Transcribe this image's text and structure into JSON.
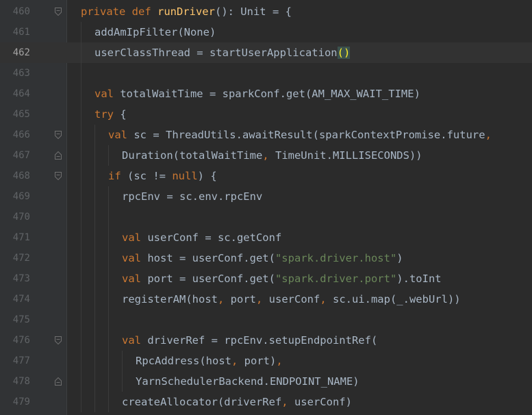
{
  "editor": {
    "colors": {
      "background": "#2b2b2b",
      "gutter": "#313335",
      "line_number": "#606366",
      "keyword": "#cc7832",
      "string": "#6a8759",
      "function_def": "#ffc66d",
      "plain": "#a9b7c6",
      "brace_match_bg": "#3b514d",
      "brace_match_fg": "#ffef28"
    },
    "current_line": "462",
    "lines": [
      {
        "num": "460",
        "fold": "open",
        "indent": 0,
        "tokens": [
          {
            "t": "private def ",
            "c": "kw"
          },
          {
            "t": "runDriver",
            "c": "fn"
          },
          {
            "t": "(): Unit = {",
            "c": "plain"
          }
        ]
      },
      {
        "num": "461",
        "fold": "",
        "indent": 1,
        "tokens": [
          {
            "t": "addAmIpFilter(None)",
            "c": "plain"
          }
        ]
      },
      {
        "num": "462",
        "fold": "",
        "indent": 1,
        "tokens": [
          {
            "t": "userClassThread = startUserApplication",
            "c": "plain"
          },
          {
            "t": "()",
            "c": "match"
          }
        ]
      },
      {
        "num": "463",
        "fold": "",
        "indent": 1,
        "tokens": []
      },
      {
        "num": "464",
        "fold": "",
        "indent": 1,
        "tokens": [
          {
            "t": "val ",
            "c": "kw"
          },
          {
            "t": "totalWaitTime = sparkConf.get(AM_MAX_WAIT_TIME)",
            "c": "plain"
          }
        ]
      },
      {
        "num": "465",
        "fold": "",
        "indent": 1,
        "tokens": [
          {
            "t": "try ",
            "c": "kw"
          },
          {
            "t": "{",
            "c": "plain"
          }
        ]
      },
      {
        "num": "466",
        "fold": "open",
        "indent": 2,
        "tokens": [
          {
            "t": "val ",
            "c": "kw"
          },
          {
            "t": "sc = ThreadUtils.awaitResult(sparkContextPromise.future",
            "c": "plain"
          },
          {
            "t": ",",
            "c": "kw"
          }
        ]
      },
      {
        "num": "467",
        "fold": "close",
        "indent": 3,
        "tokens": [
          {
            "t": "Duration(totalWaitTime",
            "c": "plain"
          },
          {
            "t": ", ",
            "c": "kw"
          },
          {
            "t": "TimeUnit.MILLISECONDS))",
            "c": "plain"
          }
        ]
      },
      {
        "num": "468",
        "fold": "open",
        "indent": 2,
        "tokens": [
          {
            "t": "if ",
            "c": "kw"
          },
          {
            "t": "(sc != ",
            "c": "plain"
          },
          {
            "t": "null",
            "c": "kw"
          },
          {
            "t": ") {",
            "c": "plain"
          }
        ]
      },
      {
        "num": "469",
        "fold": "",
        "indent": 3,
        "tokens": [
          {
            "t": "rpcEnv = sc.env.rpcEnv",
            "c": "plain"
          }
        ]
      },
      {
        "num": "470",
        "fold": "",
        "indent": 3,
        "tokens": []
      },
      {
        "num": "471",
        "fold": "",
        "indent": 3,
        "tokens": [
          {
            "t": "val ",
            "c": "kw"
          },
          {
            "t": "userConf = sc.getConf",
            "c": "plain"
          }
        ]
      },
      {
        "num": "472",
        "fold": "",
        "indent": 3,
        "tokens": [
          {
            "t": "val ",
            "c": "kw"
          },
          {
            "t": "host = userConf.get(",
            "c": "plain"
          },
          {
            "t": "\"spark.driver.host\"",
            "c": "str"
          },
          {
            "t": ")",
            "c": "plain"
          }
        ]
      },
      {
        "num": "473",
        "fold": "",
        "indent": 3,
        "tokens": [
          {
            "t": "val ",
            "c": "kw"
          },
          {
            "t": "port = userConf.get(",
            "c": "plain"
          },
          {
            "t": "\"spark.driver.port\"",
            "c": "str"
          },
          {
            "t": ").toInt",
            "c": "plain"
          }
        ]
      },
      {
        "num": "474",
        "fold": "",
        "indent": 3,
        "tokens": [
          {
            "t": "registerAM(host",
            "c": "plain"
          },
          {
            "t": ", ",
            "c": "kw"
          },
          {
            "t": "port",
            "c": "plain"
          },
          {
            "t": ", ",
            "c": "kw"
          },
          {
            "t": "userConf",
            "c": "plain"
          },
          {
            "t": ", ",
            "c": "kw"
          },
          {
            "t": "sc.ui.map(_.webUrl))",
            "c": "plain"
          }
        ]
      },
      {
        "num": "475",
        "fold": "",
        "indent": 3,
        "tokens": []
      },
      {
        "num": "476",
        "fold": "open",
        "indent": 3,
        "tokens": [
          {
            "t": "val ",
            "c": "kw"
          },
          {
            "t": "driverRef = rpcEnv.setupEndpointRef(",
            "c": "plain"
          }
        ]
      },
      {
        "num": "477",
        "fold": "",
        "indent": 4,
        "tokens": [
          {
            "t": "RpcAddress(host",
            "c": "plain"
          },
          {
            "t": ", ",
            "c": "kw"
          },
          {
            "t": "port)",
            "c": "plain"
          },
          {
            "t": ",",
            "c": "kw"
          }
        ]
      },
      {
        "num": "478",
        "fold": "close",
        "indent": 4,
        "tokens": [
          {
            "t": "YarnSchedulerBackend.ENDPOINT_NAME)",
            "c": "plain"
          }
        ]
      },
      {
        "num": "479",
        "fold": "",
        "indent": 3,
        "tokens": [
          {
            "t": "createAllocator(driverRef",
            "c": "plain"
          },
          {
            "t": ", ",
            "c": "kw"
          },
          {
            "t": "userConf)",
            "c": "plain"
          }
        ]
      }
    ]
  }
}
